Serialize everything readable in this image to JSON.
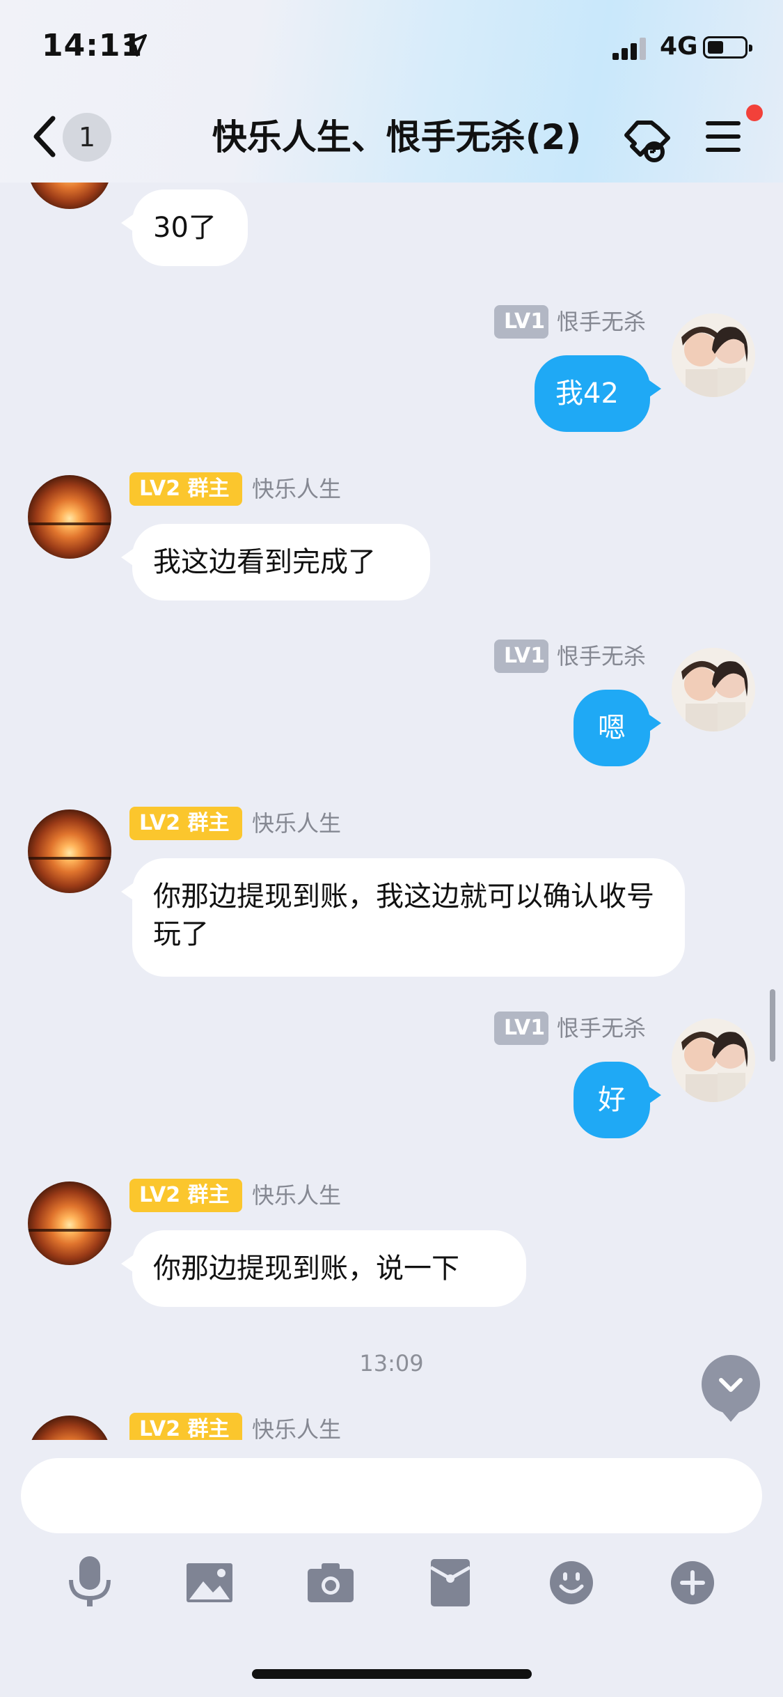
{
  "status_bar": {
    "time": "14:11",
    "network": "4G"
  },
  "nav": {
    "unread_count": "1",
    "title": "快乐人生、恨手无杀(2)"
  },
  "chat": {
    "messages": [
      {
        "side": "in",
        "text": "30了"
      },
      {
        "side": "out",
        "level": "LV1",
        "sender": "恨手无杀",
        "text": "我42"
      },
      {
        "side": "in",
        "level": "LV2",
        "role": "群主",
        "sender": "快乐人生",
        "text": "我这边看到完成了"
      },
      {
        "side": "out",
        "level": "LV1",
        "sender": "恨手无杀",
        "text": "嗯"
      },
      {
        "side": "in",
        "level": "LV2",
        "role": "群主",
        "sender": "快乐人生",
        "text": "你那边提现到账，我这边就可以确认收号玩了"
      },
      {
        "side": "out",
        "level": "LV1",
        "sender": "恨手无杀",
        "text": "好"
      },
      {
        "side": "in",
        "level": "LV2",
        "role": "群主",
        "sender": "快乐人生",
        "text": "你那边提现到账，说一下"
      },
      {
        "side": "in",
        "level": "LV2",
        "role": "群主",
        "sender": "快乐人生",
        "text": ""
      }
    ],
    "time_separator": "13:09"
  },
  "input": {
    "value": "",
    "placeholder": ""
  },
  "toolbar": [
    "microphone-icon",
    "image-icon",
    "camera-icon",
    "red-packet-icon",
    "emoji-icon",
    "plus-icon"
  ],
  "colors": {
    "outgoing_bubble": "#1fa9f5",
    "owner_badge": "#fbc62d",
    "member_badge": "#b2b7c4",
    "notification_dot": "#f2413a"
  }
}
